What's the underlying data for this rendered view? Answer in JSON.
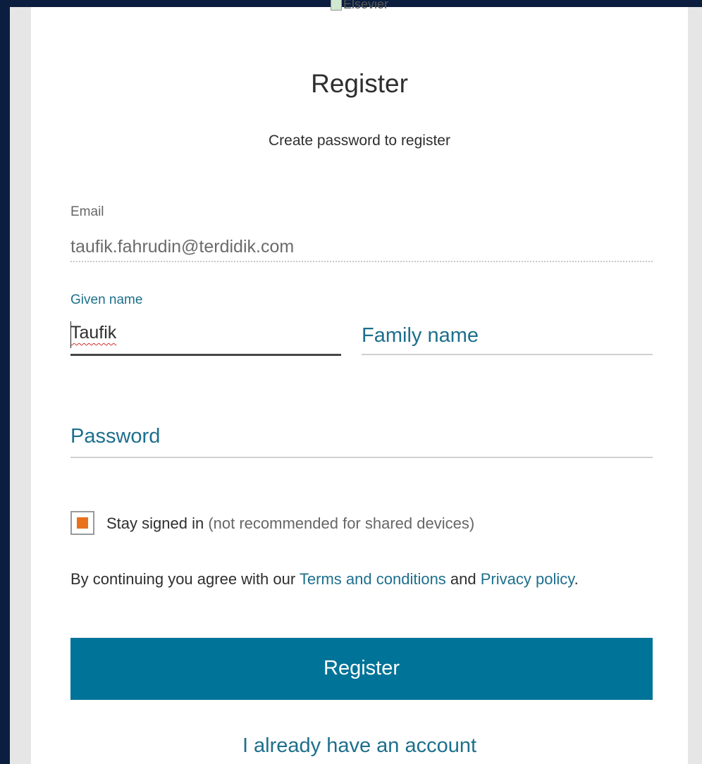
{
  "header": {
    "logo_alt": "Elsevier"
  },
  "form": {
    "title": "Register",
    "subtitle": "Create password to register",
    "email": {
      "label": "Email",
      "value": "taufik.fahrudin@terdidik.com"
    },
    "given_name": {
      "label": "Given name",
      "value": "Taufik"
    },
    "family_name": {
      "placeholder": "Family name"
    },
    "password": {
      "placeholder": "Password"
    },
    "stay_signed_in": {
      "label": "Stay signed in",
      "note": "(not recommended for shared devices)",
      "checked": true,
      "color": "#e9711c"
    },
    "terms": {
      "prefix": "By continuing you agree with our ",
      "terms_link": "Terms and conditions",
      "middle": " and ",
      "privacy_link": "Privacy policy",
      "suffix": "."
    },
    "register_button": "Register",
    "have_account_link": "I already have an account"
  },
  "colors": {
    "accent": "#007398",
    "link": "#1d6f8c",
    "background": "#0c1e3f"
  }
}
